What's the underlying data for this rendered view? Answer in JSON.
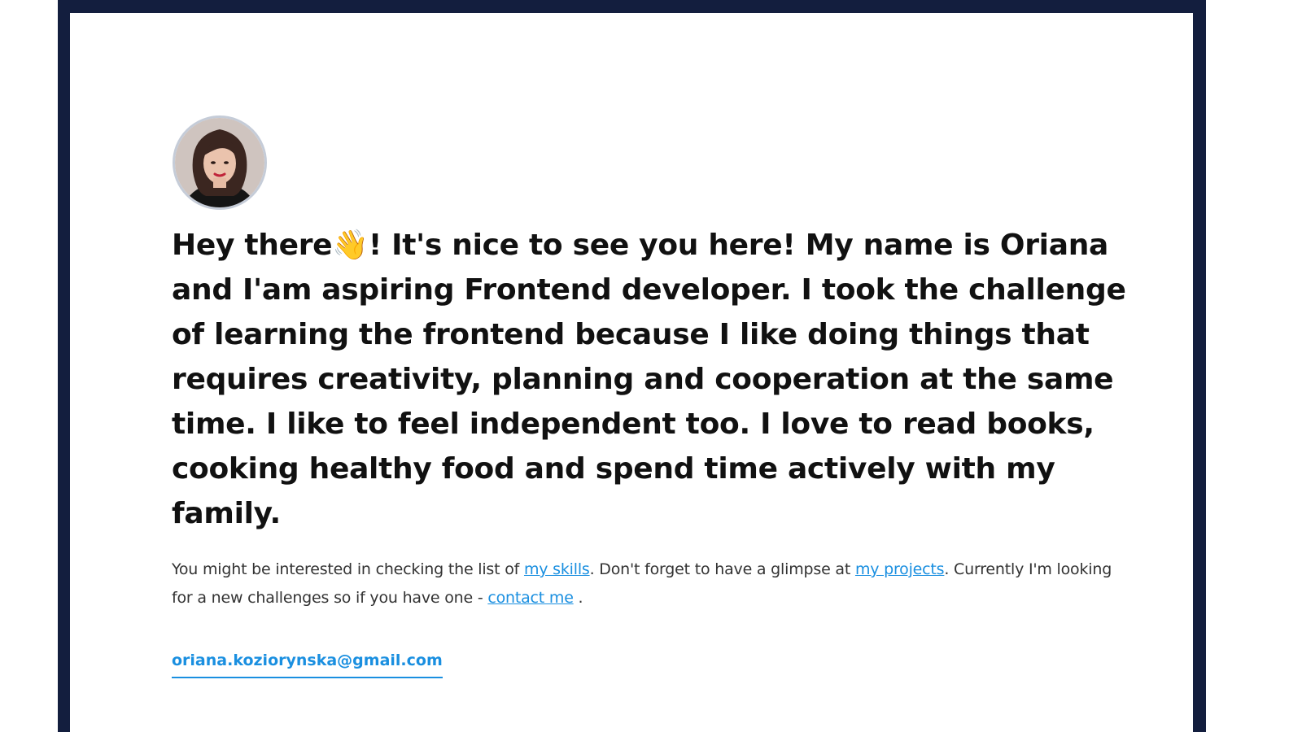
{
  "colors": {
    "frame": "#131e3e",
    "card": "#ffffff",
    "heading_text": "#111111",
    "body_text": "#333333",
    "link": "#1a8fe0",
    "avatar_border": "#c5ccd8"
  },
  "avatar": {
    "alt": "Oriana Koziorynska profile photo"
  },
  "heading": {
    "before_icon": "Hey there",
    "icon": "waving-hand-icon",
    "icon_glyph": "👋",
    "after_icon": "! It's nice to see you here! My name is Oriana and I'am aspiring Frontend developer. I took the challenge of learning the frontend because I like doing things that requires creativity, planning and cooperation at the same time. I like to feel independent too. I love to read books, cooking healthy food and spend time actively with my family."
  },
  "paragraph": {
    "text_1": "You might be interested in checking the list of ",
    "link_skills": "my skills",
    "text_2": ". Don't forget to have a glimpse at ",
    "link_projects": "my projects",
    "text_3": ". Currently I'm looking for a new challenges so if you have one - ",
    "link_contact": "contact me",
    "text_4": " ."
  },
  "contact": {
    "email": "oriana.koziorynska@gmail.com"
  }
}
